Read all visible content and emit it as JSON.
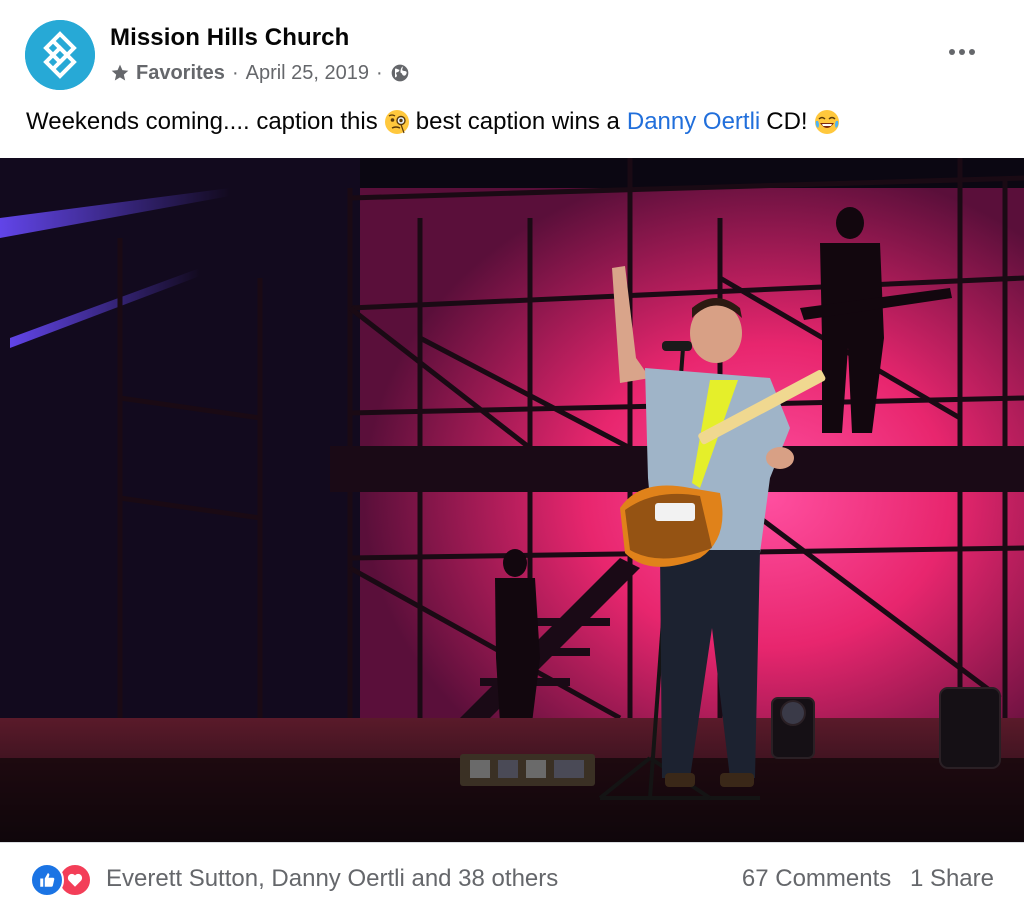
{
  "post": {
    "page_name": "Mission Hills Church",
    "audience_label": "Favorites",
    "separator": "·",
    "date": "April 25, 2019",
    "more_icon": "more-horizontal-icon",
    "caption": {
      "before_emoji": "Weekends coming.... caption this",
      "emoji_1": "face-with-monocle-emoji",
      "middle": "best caption wins a",
      "link": "Danny Oertli",
      "after_link": "CD!",
      "emoji_2": "tears-of-joy-emoji"
    },
    "photo": "worship leader singing with electric guitar on stage with scaffolding and magenta lighting"
  },
  "footer": {
    "reaction_icons": [
      "like-icon",
      "love-icon"
    ],
    "reactors": "Everett Sutton, Danny Oertli and 38 others",
    "comments": "67 Comments",
    "shares": "1 Share"
  },
  "colors": {
    "link": "#216fdb",
    "muted": "#65676b",
    "avatar": "#27a9d6",
    "like": "#1b74e4",
    "love": "#f33e58",
    "stage_backdrop": "#e8266e"
  }
}
